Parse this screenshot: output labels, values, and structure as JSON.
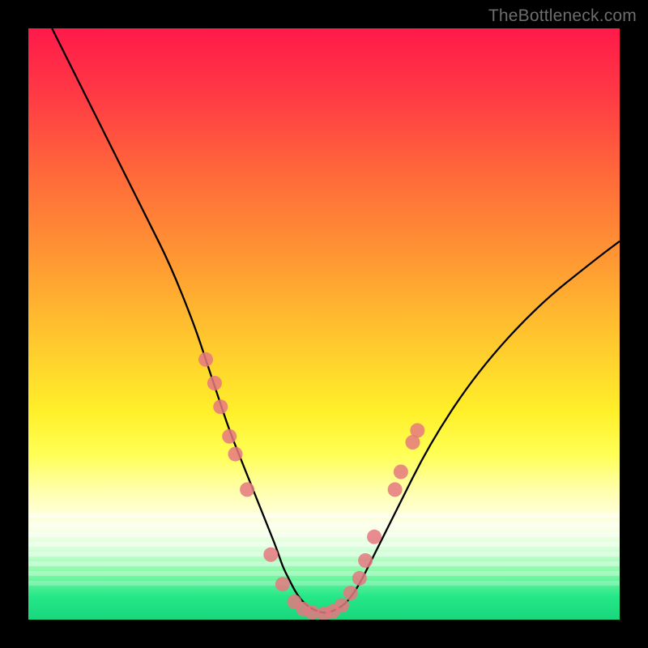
{
  "watermark": {
    "text": "TheBottleneck.com"
  },
  "colors": {
    "frame": "#000000",
    "curve": "#000000",
    "dot_fill": "#e57880",
    "dot_stroke": "#9c3b45",
    "gradient_top": "#ff1a4a",
    "gradient_bottom": "#18d67c"
  },
  "chart_data": {
    "type": "line",
    "title": "",
    "xlabel": "",
    "ylabel": "",
    "xlim": [
      0,
      100
    ],
    "ylim": [
      0,
      100
    ],
    "grid": false,
    "legend": false,
    "series": [
      {
        "name": "curve",
        "x": [
          4,
          8,
          12,
          16,
          20,
          24,
          28,
          30,
          32,
          34,
          36,
          38,
          40,
          42,
          43,
          44,
          45,
          46,
          47,
          48,
          50,
          52,
          54,
          56,
          58,
          62,
          68,
          76,
          86,
          96,
          100
        ],
        "y": [
          100,
          92,
          84,
          76,
          68,
          60,
          50,
          44,
          38,
          32,
          27,
          22,
          17,
          12,
          9,
          7,
          5,
          3.5,
          2.5,
          1.8,
          1,
          1.6,
          3,
          6,
          10,
          18,
          30,
          42,
          53,
          61,
          64
        ]
      }
    ],
    "dots": {
      "name": "markers",
      "points": [
        {
          "x": 30.0,
          "y": 44
        },
        {
          "x": 31.5,
          "y": 40
        },
        {
          "x": 32.5,
          "y": 36
        },
        {
          "x": 34.0,
          "y": 31
        },
        {
          "x": 35.0,
          "y": 28
        },
        {
          "x": 37.0,
          "y": 22
        },
        {
          "x": 41.0,
          "y": 11
        },
        {
          "x": 43.0,
          "y": 6
        },
        {
          "x": 45.0,
          "y": 3
        },
        {
          "x": 46.5,
          "y": 1.8
        },
        {
          "x": 48.0,
          "y": 1.2
        },
        {
          "x": 50.0,
          "y": 1.0
        },
        {
          "x": 51.5,
          "y": 1.4
        },
        {
          "x": 53.0,
          "y": 2.4
        },
        {
          "x": 54.5,
          "y": 4.5
        },
        {
          "x": 56.0,
          "y": 7
        },
        {
          "x": 57.0,
          "y": 10
        },
        {
          "x": 58.5,
          "y": 14
        },
        {
          "x": 62.0,
          "y": 22
        },
        {
          "x": 63.0,
          "y": 25
        },
        {
          "x": 65.0,
          "y": 30
        },
        {
          "x": 65.8,
          "y": 32
        }
      ]
    }
  }
}
